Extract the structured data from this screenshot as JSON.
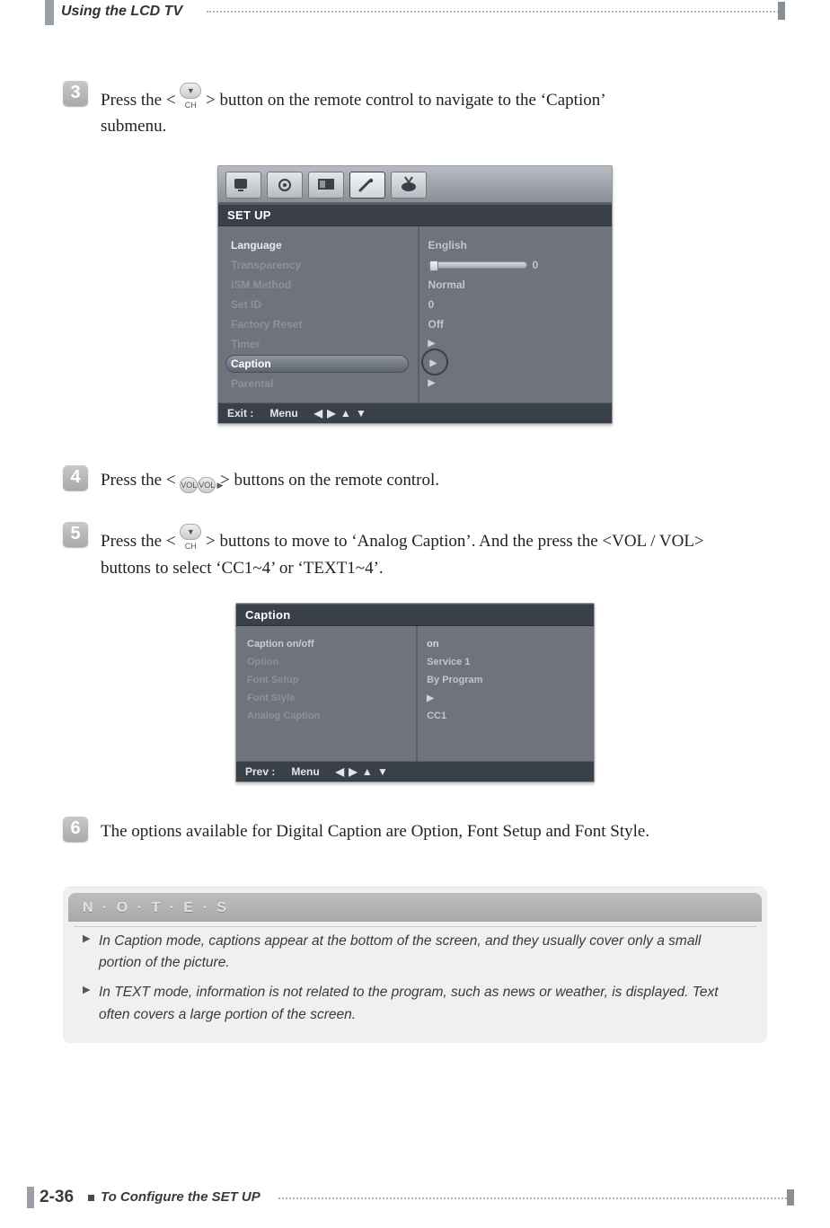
{
  "header": {
    "section_title": "Using the LCD TV"
  },
  "steps": {
    "s3": {
      "num": "3",
      "text_a": "Press the <",
      "text_b": "> button on the remote control to navigate to the ‘Caption’",
      "text_c": "submenu.",
      "icon": "▼ CH"
    },
    "s4": {
      "num": "4",
      "text_a": "Press the <",
      "text_b": "> buttons on the remote control.",
      "iconL": "VOL ◀",
      "iconR": "VOL ▶"
    },
    "s5": {
      "num": "5",
      "text_a": "Press the <",
      "text_b": "> buttons to move to ‘Analog Caption’. And the press the <VOL / VOL>",
      "text_c": "buttons to select ‘CC1~4’ or ‘TEXT1~4’.",
      "icon": "▼ CH"
    },
    "s6": {
      "num": "6",
      "text": "The options available for Digital Caption are Option, Font Setup and Font Style."
    }
  },
  "setup_osd": {
    "title": "SET UP",
    "items": [
      {
        "label": "Language",
        "value": "English"
      },
      {
        "label": "Transparency",
        "value": "0",
        "slider": true
      },
      {
        "label": "ISM Method",
        "value": "Normal"
      },
      {
        "label": "Set ID",
        "value": "0"
      },
      {
        "label": "Factory Reset",
        "value": "Off"
      },
      {
        "label": "Timer",
        "value": "▶"
      },
      {
        "label": "Caption",
        "value": "▶",
        "selected": true
      },
      {
        "label": "Parental",
        "value": "▶"
      }
    ],
    "footer_exit": "Exit :",
    "footer_menu": "Menu",
    "footer_nav": "◀ ▶ ▲ ▼"
  },
  "caption_osd": {
    "title": "Caption",
    "items": [
      {
        "label": "Caption on/off",
        "value": "on",
        "highlight": true
      },
      {
        "label": "Option",
        "value": "Service 1"
      },
      {
        "label": "Font Setup",
        "value": "By Program"
      },
      {
        "label": "Font Style",
        "value": "▶"
      },
      {
        "label": "Analog Caption",
        "value": "CC1"
      }
    ],
    "footer_prev": "Prev :",
    "footer_menu": "Menu",
    "footer_nav": "◀ ▶ ▲ ▼"
  },
  "notes": {
    "heading": "N · O · T · E · S",
    "items": [
      "In Caption mode, captions appear at the bottom of the screen, and they usually cover only a small portion of the picture.",
      "In TEXT mode, information is not related to the program, such as news or weather, is displayed. Text often covers a large portion of the screen."
    ]
  },
  "footer": {
    "page_num": "2-36",
    "section": "To Configure the SET UP"
  }
}
